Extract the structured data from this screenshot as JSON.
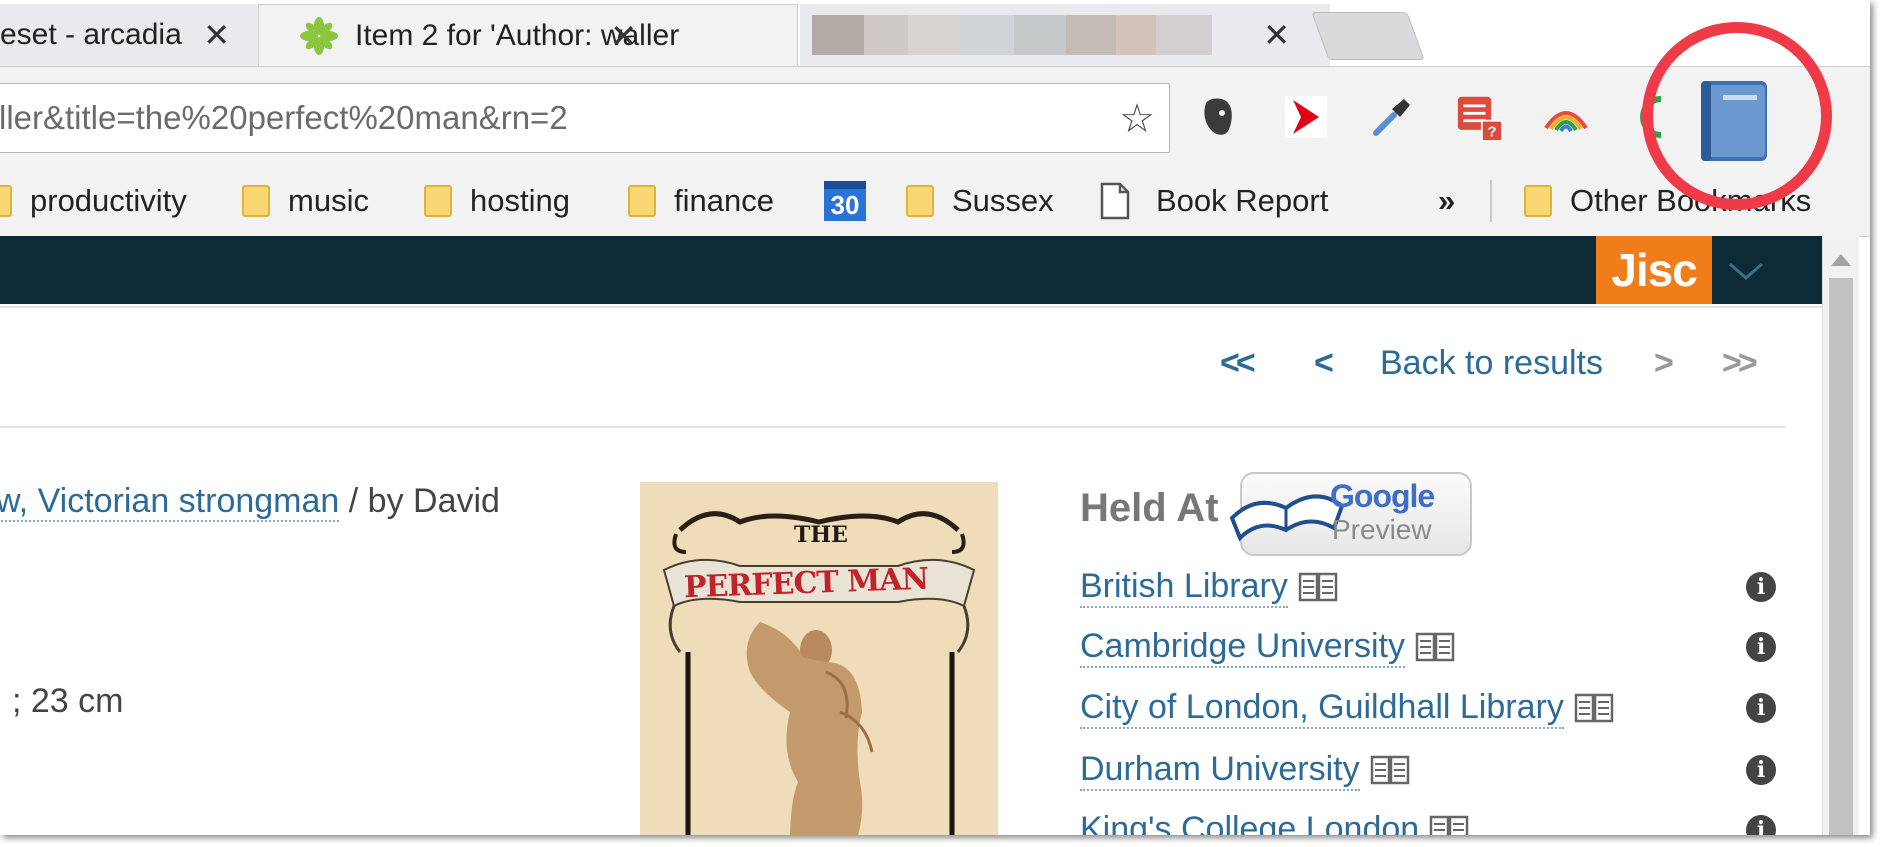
{
  "tabs": [
    {
      "title": "eset - arcadia",
      "close": "✕"
    },
    {
      "title": "Item 2 for 'Author: waller",
      "close": "✕"
    },
    {
      "title": "",
      "close": "✕"
    }
  ],
  "omnibox": {
    "value": "ller&title=the%20perfect%20man&rn=2"
  },
  "extensions": [
    "evernote-icon",
    "arrow-red-icon",
    "eyedropper-icon",
    "todoist-icon",
    "rainbow-icon",
    "green-circle-icon",
    "book-extension-icon"
  ],
  "bookmarks": {
    "items": [
      {
        "label": "productivity",
        "icon": "folder-icon"
      },
      {
        "label": "music",
        "icon": "folder-icon"
      },
      {
        "label": "hosting",
        "icon": "folder-icon"
      },
      {
        "label": "finance",
        "icon": "folder-icon"
      },
      {
        "label": "30",
        "icon": "calendar-icon"
      },
      {
        "label": "Sussex",
        "icon": "folder-icon"
      },
      {
        "label": "Book Report",
        "icon": "page-icon"
      }
    ],
    "overflow": "»",
    "other": "Other Bookmarks"
  },
  "site": {
    "brand": "Jisc"
  },
  "navigation": {
    "first": "<<",
    "prev": "<",
    "back": "Back to results",
    "next": ">",
    "last": ">>"
  },
  "record": {
    "title_link": "w, Victorian strongman",
    "title_rest": " / by David",
    "extent": "; 23 cm"
  },
  "cover": {
    "top": "THE",
    "title": "PERFECT MAN"
  },
  "held_at": {
    "heading": "Held At",
    "preview_brand": "Google",
    "preview_label": "Preview",
    "libraries": [
      "British Library",
      "Cambridge University",
      "City of London, Guildhall Library",
      "Durham University",
      "King's College London"
    ]
  },
  "colors": {
    "link": "#2c6a98",
    "header": "#0d2b36",
    "jisc": "#f07d1a",
    "highlight": "#ef3b47"
  }
}
